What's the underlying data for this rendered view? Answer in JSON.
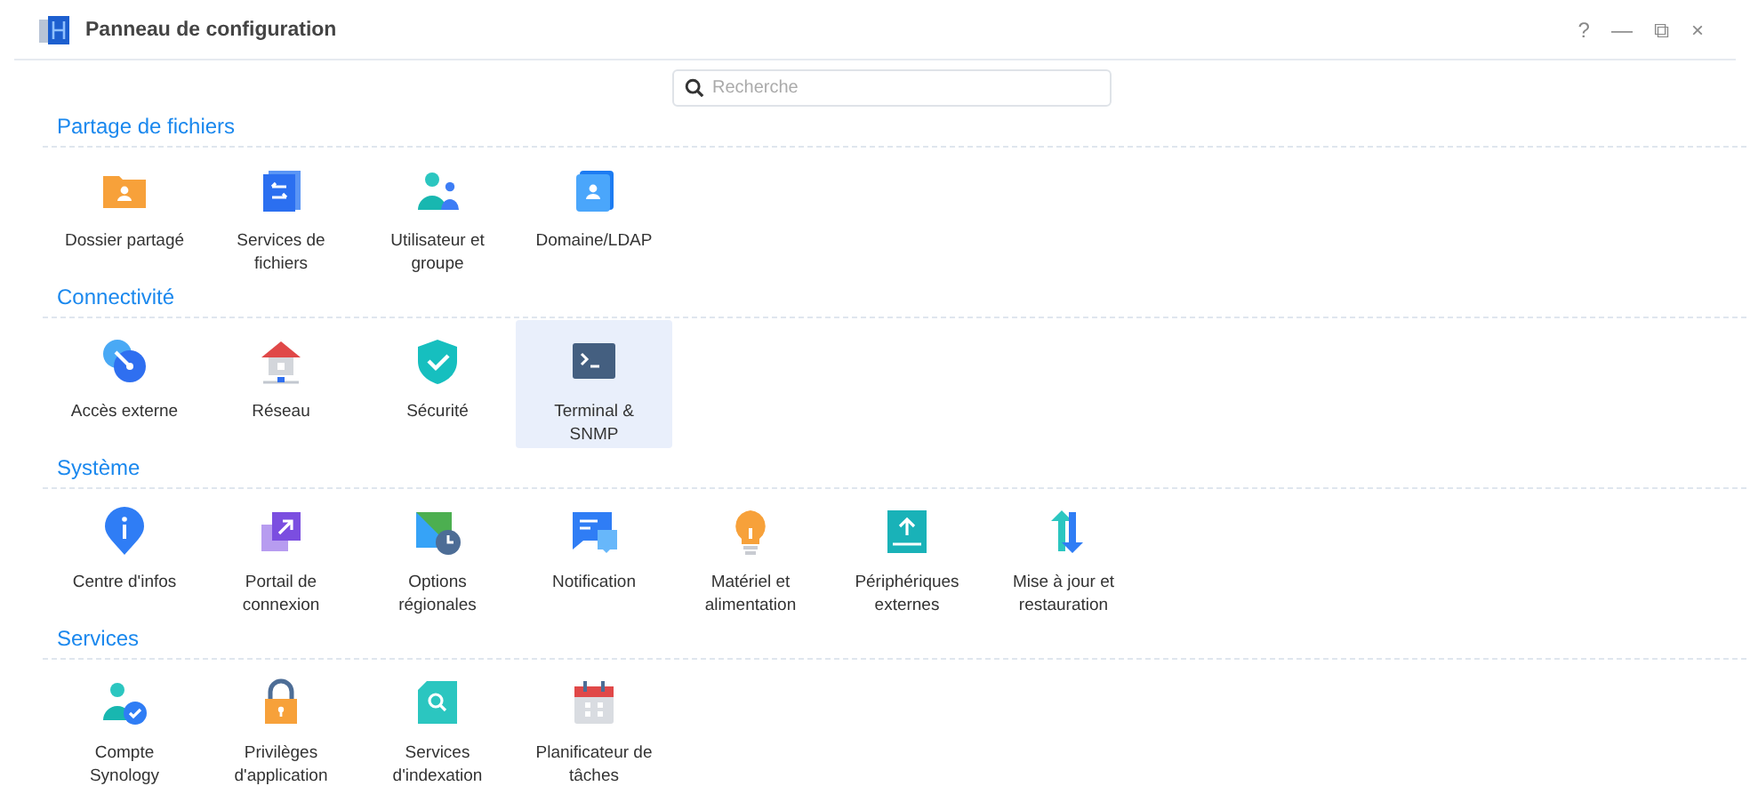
{
  "window": {
    "title": "Panneau de configuration",
    "controls": [
      "?",
      "—",
      "⧉",
      "×"
    ]
  },
  "search": {
    "placeholder": "Recherche"
  },
  "sections": [
    {
      "title": "Partage de fichiers",
      "items": [
        {
          "label": "Dossier partagé",
          "selected": false
        },
        {
          "label": "Services de fichiers",
          "selected": false
        },
        {
          "label": "Utilisateur et groupe",
          "selected": false
        },
        {
          "label": "Domaine/LDAP",
          "selected": false
        }
      ]
    },
    {
      "title": "Connectivité",
      "items": [
        {
          "label": "Accès externe",
          "selected": false
        },
        {
          "label": "Réseau",
          "selected": false
        },
        {
          "label": "Sécurité",
          "selected": false
        },
        {
          "label": "Terminal & SNMP",
          "selected": true
        }
      ]
    },
    {
      "title": "Système",
      "items": [
        {
          "label": "Centre d'infos",
          "selected": false
        },
        {
          "label": "Portail de connexion",
          "selected": false
        },
        {
          "label": "Options régionales",
          "selected": false
        },
        {
          "label": "Notification",
          "selected": false
        },
        {
          "label": "Matériel et alimentation",
          "selected": false
        },
        {
          "label": "Périphériques externes",
          "selected": false
        },
        {
          "label": "Mise à jour et restauration",
          "selected": false
        }
      ]
    },
    {
      "title": "Services",
      "items": [
        {
          "label": "Compte Synology",
          "selected": false
        },
        {
          "label": "Privilèges d'application",
          "selected": false
        },
        {
          "label": "Services d'indexation",
          "selected": false
        },
        {
          "label": "Planificateur de tâches",
          "selected": false
        }
      ]
    }
  ]
}
